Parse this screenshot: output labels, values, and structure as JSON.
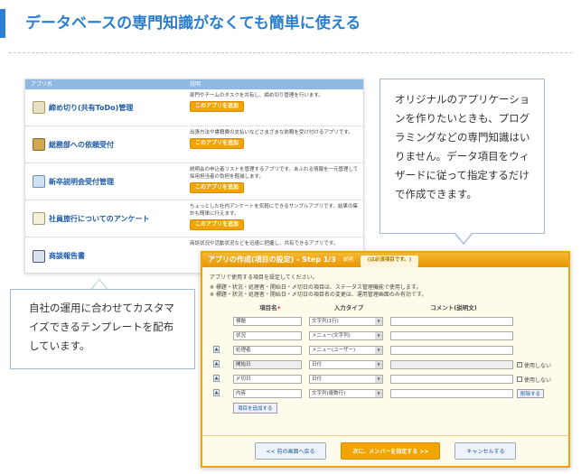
{
  "page": {
    "title": "データベースの専門知識がなくても簡単に使える"
  },
  "templates": {
    "col_name": "アプリ名",
    "col_desc": "説明",
    "add_label": "このアプリを追加",
    "rows": [
      {
        "name": "締め切り(共有ToDo)管理",
        "icon": "todo-icon",
        "desc": "部門やチームのタスクを共有し、締め切り管理を行います。"
      },
      {
        "name": "総務部への依頼受付",
        "icon": "inbox-icon",
        "desc": "出張方法や書籍費の支払いなどさまざまな依頼を受け付けるアプリです。"
      },
      {
        "name": "新卒説明会受付管理",
        "icon": "people-icon",
        "desc": "説明会の申込者リストを管理するアプリです。あふれる情報を一元管理して採用担当者の負担を軽減します。"
      },
      {
        "name": "社員旅行についてのアンケート",
        "icon": "survey-icon",
        "desc": "ちょっとした社内アンケートを気軽にできるサンプルアプリです。結果の集計も簡単に行えます。"
      },
      {
        "name": "商談報告書",
        "icon": "report-icon",
        "desc": "商談状況や活動状況などを迅速に把握し、共有できるアプリです。"
      }
    ]
  },
  "callouts": {
    "left": "自社の運用に合わせてカスタマイズできるテンプレートを配布しています。",
    "right": "オリジナルのアプリケーションを作りたいときも、プログラミングなどの専門知識はいりません。データ項目をウィザードに従って指定するだけで作成できます。"
  },
  "wizard": {
    "title": "アプリの作成(項目の設定) - Step 1/3",
    "title_sub": "説明",
    "title_note": "(は必須項目です。)",
    "intro": "アプリで使用する項目を設定してください。",
    "warn1": "※ 標題・状況・処理者・開始日・〆切日の項目は、ステータス管理機能で使用します。",
    "warn2": "※ 標題・状況・処理者・開始日・〆切日の項目名の変更は、運用管理画面のみ有効です。",
    "col_name": "項目名",
    "col_name_req": "•",
    "col_type": "入力タイプ",
    "col_comment": "コメント(説明文)",
    "rows": [
      {
        "name": "標題",
        "type": "文字列(1行)",
        "extra": ""
      },
      {
        "name": "状況",
        "type": "メニュー(文字列)",
        "extra": ""
      },
      {
        "name": "処理者",
        "type": "メニュー(ユーザー)",
        "extra": ""
      },
      {
        "name": "開始日",
        "type": "日付",
        "extra": "使用しない",
        "checked": true
      },
      {
        "name": "〆切日",
        "type": "日付",
        "extra": "使用しない",
        "checked": false
      },
      {
        "name": "内容",
        "type": "文字列(複数行)",
        "extra": "削除する"
      }
    ],
    "add_item": "項目を追加する",
    "back_button": "<< 前の画面へ戻る",
    "next_button": "次に、メンバーを指定する >>",
    "cancel_button": "キャンセルする"
  }
}
